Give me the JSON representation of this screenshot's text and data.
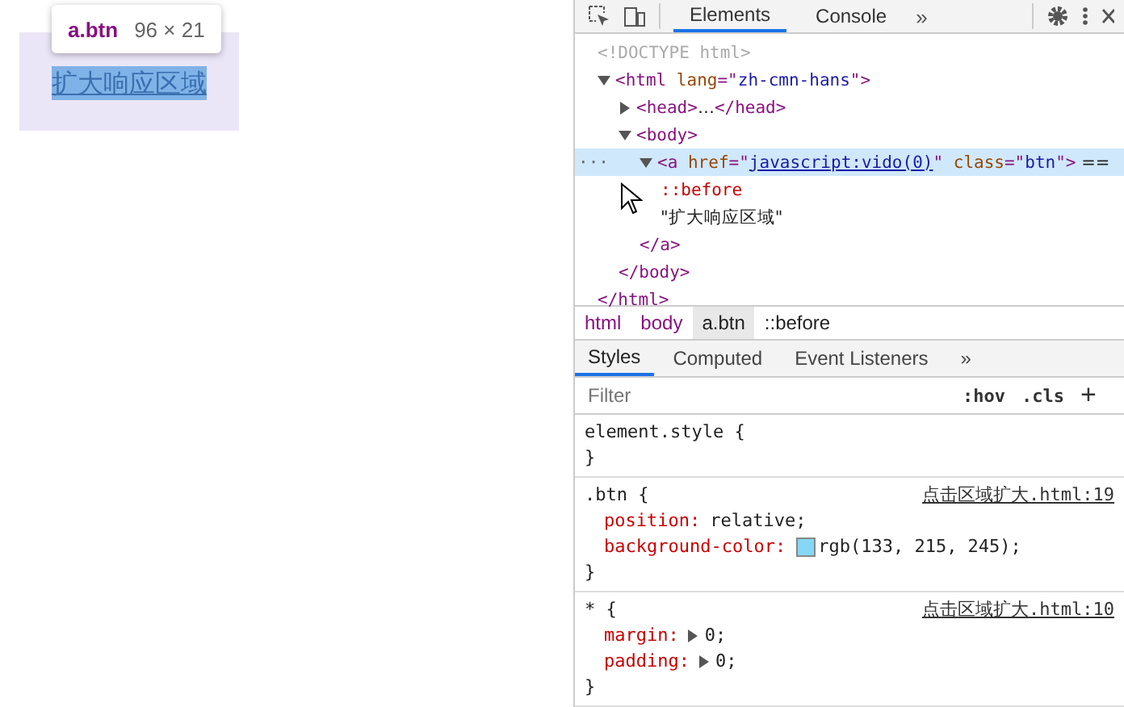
{
  "page": {
    "link_text": "扩大响应区域",
    "tooltip": {
      "selector": "a.btn",
      "size": "96 × 21"
    }
  },
  "devtools": {
    "tabs": [
      {
        "label": "Elements",
        "selected": true
      },
      {
        "label": "Console",
        "selected": false
      }
    ],
    "tabs_overflow": "»",
    "dom_tree": [
      {
        "tokens": [
          {
            "kind": "doctype",
            "text": "<!DOCTYPE html>"
          }
        ]
      },
      {
        "expanded": true,
        "selected": false,
        "tokens": [
          {
            "kind": "tag",
            "text": "<html"
          },
          {
            "kind": "attr-name",
            "text": " lang"
          },
          {
            "kind": "tag",
            "text": "=\""
          },
          {
            "kind": "attr-value",
            "text": "zh-cmn-hans"
          },
          {
            "kind": "tag",
            "text": "\">"
          }
        ],
        "closing": [
          {
            "kind": "tag",
            "text": "</html>"
          }
        ],
        "children": [
          {
            "expanded": false,
            "selected": false,
            "tokens": [
              {
                "kind": "tag",
                "text": "<head>"
              },
              {
                "kind": "text",
                "text": "…"
              },
              {
                "kind": "tag",
                "text": "</head>"
              }
            ]
          },
          {
            "expanded": true,
            "selected": false,
            "tokens": [
              {
                "kind": "tag",
                "text": "<body>"
              }
            ],
            "closing": [
              {
                "kind": "tag",
                "text": "</body>"
              }
            ],
            "children": [
              {
                "expanded": true,
                "selected": true,
                "marker": "···",
                "tokens": [
                  {
                    "kind": "tag",
                    "text": "<a"
                  },
                  {
                    "kind": "attr-name",
                    "text": " href"
                  },
                  {
                    "kind": "tag",
                    "text": "=\""
                  },
                  {
                    "kind": "link",
                    "text": "javascript:vido(0)"
                  },
                  {
                    "kind": "tag",
                    "text": "\""
                  },
                  {
                    "kind": "attr-name",
                    "text": " class"
                  },
                  {
                    "kind": "tag",
                    "text": "=\""
                  },
                  {
                    "kind": "attr-value",
                    "text": "btn"
                  },
                  {
                    "kind": "tag",
                    "text": "\">"
                  },
                  {
                    "kind": "text",
                    "text": " =="
                  }
                ],
                "closing": [
                  {
                    "kind": "tag",
                    "text": "</a>"
                  }
                ],
                "children": [
                  {
                    "tokens": [
                      {
                        "kind": "pseudo",
                        "text": "::before"
                      }
                    ]
                  },
                  {
                    "tokens": [
                      {
                        "kind": "text",
                        "text": "\"扩大响应区域\""
                      }
                    ]
                  }
                ]
              }
            ]
          }
        ]
      }
    ],
    "breadcrumbs": [
      {
        "label": "html",
        "selected": false
      },
      {
        "label": "body",
        "selected": false
      },
      {
        "label": "a.btn",
        "selected": true
      },
      {
        "label": "::before",
        "selected": false
      }
    ],
    "styles_tabs": [
      {
        "label": "Styles",
        "selected": true
      },
      {
        "label": "Computed",
        "selected": false
      },
      {
        "label": "Event Listeners",
        "selected": false
      }
    ],
    "styles_tabs_overflow": "»",
    "filter": {
      "placeholder": "Filter"
    },
    "filter_buttons": [
      ":hov",
      ".cls"
    ],
    "add_button": "+",
    "rules": [
      {
        "selector": "element.style",
        "open": "{",
        "close": "}"
      },
      {
        "selector": ".btn",
        "open": "{",
        "close": "}",
        "source": "点击区域扩大.html:19",
        "declarations": [
          {
            "property": "position",
            "separator": ":",
            "value": "relative",
            "end": ";"
          },
          {
            "property": "background-color",
            "separator": ":",
            "value": "rgb(133, 215, 245)",
            "end": ";",
            "swatch": true
          }
        ]
      },
      {
        "selector": "*",
        "open": "{",
        "close": "}",
        "source": "点击区域扩大.html:10",
        "declarations": [
          {
            "property": "margin",
            "separator": ":",
            "value": "0",
            "end": ";",
            "expandable": true
          },
          {
            "property": "padding",
            "separator": ":",
            "value": "0",
            "end": ";",
            "expandable": true
          }
        ]
      }
    ]
  }
}
